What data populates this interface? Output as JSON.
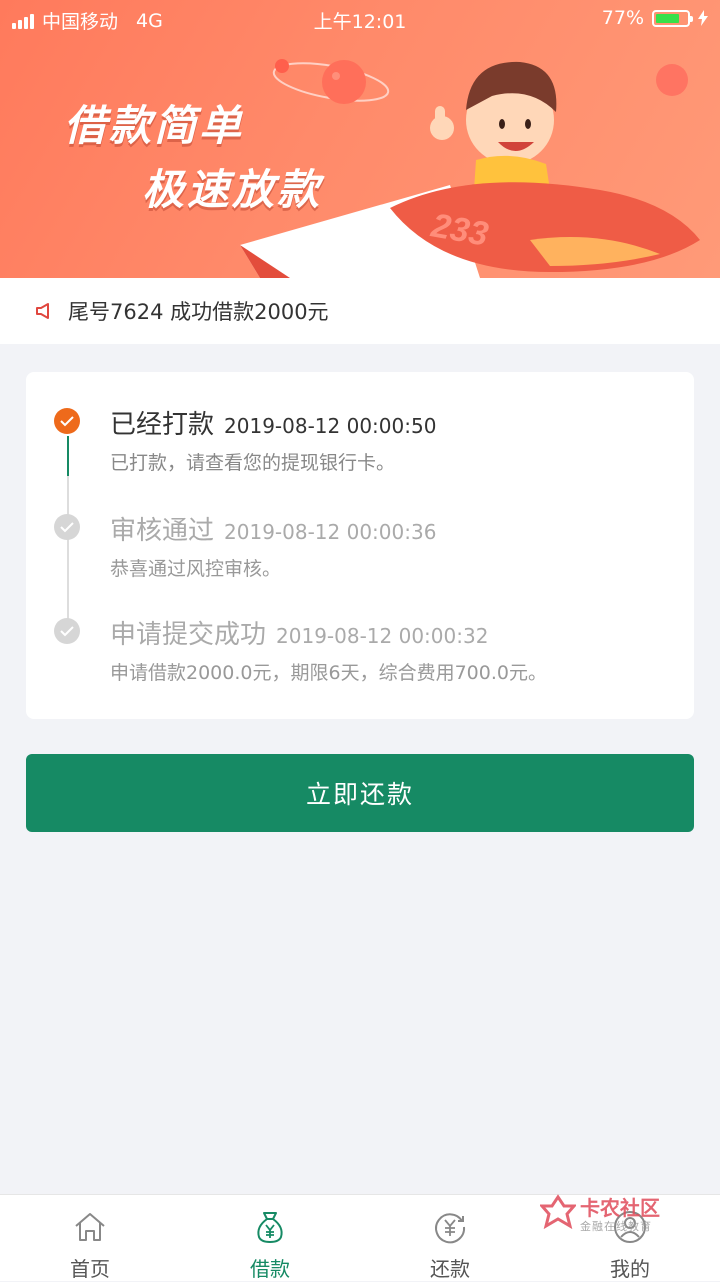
{
  "status_bar": {
    "carrier": "中国移动",
    "network": "4G",
    "time": "上午12:01",
    "battery_pct": "77%",
    "battery_level": 0.77
  },
  "banner": {
    "slogan_line1": "借款简单",
    "slogan_line2": "极速放款",
    "rocket_number": "233"
  },
  "notice": {
    "icon": "megaphone-icon",
    "text": "尾号7624 成功借款2000元"
  },
  "timeline": {
    "steps": [
      {
        "title": "已经打款",
        "time": "2019-08-12 00:00:50",
        "desc": "已打款，请查看您的提现银行卡。",
        "state": "active"
      },
      {
        "title": "审核通过",
        "time": "2019-08-12 00:00:36",
        "desc": "恭喜通过风控审核。",
        "state": "done"
      },
      {
        "title": "申请提交成功",
        "time": "2019-08-12 00:00:32",
        "desc": "申请借款2000.0元，期限6天，综合费用700.0元。",
        "state": "done"
      }
    ]
  },
  "repay_button": {
    "label": "立即还款"
  },
  "tabbar": {
    "tabs": [
      {
        "label": "首页",
        "icon": "home-icon"
      },
      {
        "label": "借款",
        "icon": "money-bag-icon",
        "active": true
      },
      {
        "label": "还款",
        "icon": "repay-yen-icon"
      },
      {
        "label": "我的",
        "icon": "user-icon"
      }
    ]
  },
  "watermark": {
    "title": "卡农社区",
    "subtitle": "金融在线教育"
  },
  "colors": {
    "brand_green": "#168a64",
    "active_orange": "#ee6a1b",
    "banner_orange": "#ff8a6a",
    "inactive_grey": "#cccccc"
  }
}
